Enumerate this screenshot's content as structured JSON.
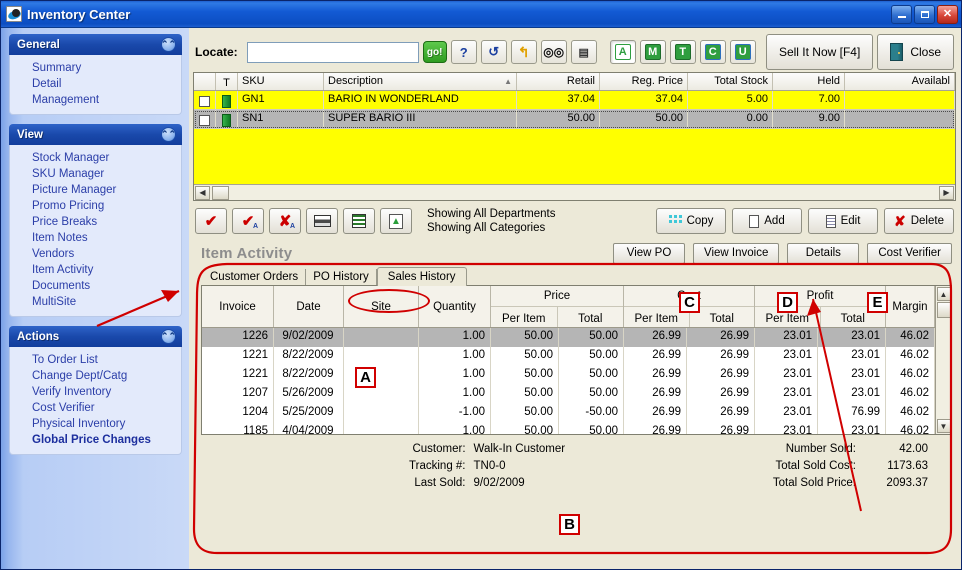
{
  "window": {
    "title": "Inventory Center",
    "minimize": "_",
    "maximize": "❐",
    "close": "✕"
  },
  "sidebar": {
    "groups": [
      {
        "title": "General",
        "collapse_icon": "chevron-up-icon",
        "items": [
          {
            "label": "Summary",
            "bold": false
          },
          {
            "label": "Detail",
            "bold": false
          },
          {
            "label": "Management",
            "bold": false
          }
        ]
      },
      {
        "title": "View",
        "collapse_icon": "chevron-up-icon",
        "items": [
          {
            "label": "Stock Manager",
            "bold": false
          },
          {
            "label": "SKU Manager",
            "bold": false
          },
          {
            "label": "Picture Manager",
            "bold": false
          },
          {
            "label": "Promo Pricing",
            "bold": false
          },
          {
            "label": "Price Breaks",
            "bold": false
          },
          {
            "label": "Item Notes",
            "bold": false
          },
          {
            "label": "Vendors",
            "bold": false
          },
          {
            "label": "Item Activity",
            "bold": false
          },
          {
            "label": "Documents",
            "bold": false
          },
          {
            "label": "MultiSite",
            "bold": false
          }
        ]
      },
      {
        "title": "Actions",
        "collapse_icon": "chevron-up-icon",
        "items": [
          {
            "label": "To Order List",
            "bold": false
          },
          {
            "label": "Change Dept/Catg",
            "bold": false
          },
          {
            "label": "Verify Inventory",
            "bold": false
          },
          {
            "label": "Cost Verifier",
            "bold": false
          },
          {
            "label": "Physical Inventory",
            "bold": false
          },
          {
            "label": "Global Price Changes",
            "bold": true
          }
        ]
      }
    ]
  },
  "toolbar": {
    "locate_label": "Locate:",
    "locate_value": "",
    "locate_placeholder": "",
    "go_label": "go!",
    "icon_buttons": [
      {
        "name": "help-icon",
        "glyph": "?"
      },
      {
        "name": "refresh-icon",
        "glyph": "↺"
      },
      {
        "name": "jump-arrow-icon",
        "glyph": "↰"
      },
      {
        "name": "binoculars-icon",
        "glyph": "🕶"
      },
      {
        "name": "preview-icon",
        "glyph": "🔍"
      }
    ],
    "letter_buttons": [
      {
        "letter": "A",
        "pressed": true
      },
      {
        "letter": "M",
        "pressed": false
      },
      {
        "letter": "T",
        "pressed": false
      },
      {
        "letter": "C",
        "pressed": false
      },
      {
        "letter": "U",
        "pressed": false
      }
    ],
    "sell_now_label": "Sell It Now [F4]",
    "close_label": "Close"
  },
  "item_grid": {
    "columns": [
      "",
      "T",
      "SKU",
      "Description",
      "Retail",
      "Reg. Price",
      "Total Stock",
      "Held",
      "Availabl"
    ],
    "sorted_column": "Description",
    "sort_glyph": "▲",
    "rows": [
      {
        "checked": false,
        "type": "item-type-indicator",
        "sku": "GN1",
        "description": "BARIO IN WONDERLAND",
        "retail": "37.04",
        "reg_price": "37.04",
        "total_stock": "5.00",
        "held": "7.00",
        "available": "",
        "selected": false
      },
      {
        "checked": false,
        "type": "item-type-indicator",
        "sku": "SN1",
        "description": "SUPER BARIO III",
        "retail": "50.00",
        "reg_price": "50.00",
        "total_stock": "0.00",
        "held": "9.00",
        "available": "",
        "selected": true
      }
    ]
  },
  "action_row": {
    "icon_buttons": [
      {
        "name": "check-all-icon",
        "glyph": "✔"
      },
      {
        "name": "check-all-a-icon",
        "glyph": "✔"
      },
      {
        "name": "uncheck-all-icon",
        "glyph": "✘"
      },
      {
        "name": "print-icon",
        "glyph": ""
      },
      {
        "name": "list-icon",
        "glyph": ""
      },
      {
        "name": "export-up-icon",
        "glyph": ""
      }
    ],
    "status_line_1": "Showing All Departments",
    "status_line_2": "Showing All Categories",
    "copy_label": "Copy",
    "add_label": "Add",
    "edit_label": "Edit",
    "delete_label": "Delete"
  },
  "item_activity": {
    "title": "Item Activity",
    "tabs": [
      {
        "label": "Customer Orders",
        "active": false
      },
      {
        "label": "PO History",
        "active": false
      },
      {
        "label": "Sales History",
        "active": true
      }
    ],
    "buttons": [
      {
        "label": "View PO"
      },
      {
        "label": "View Invoice"
      },
      {
        "label": "Details"
      },
      {
        "label": "Cost Verifier"
      }
    ],
    "grid": {
      "headers": {
        "invoice": "Invoice",
        "date": "Date",
        "site": "Site",
        "quantity": "Quantity",
        "price": "Price",
        "cost": "Cost",
        "profit": "Profit",
        "margin": "Margin",
        "per_item": "Per Item",
        "total": "Total"
      },
      "rows": [
        {
          "invoice": "1226",
          "date": "9/02/2009",
          "site": "",
          "quantity": "1.00",
          "price_per": "50.00",
          "price_total": "50.00",
          "cost_per": "26.99",
          "cost_total": "26.99",
          "profit_per": "23.01",
          "profit_total": "23.01",
          "margin": "46.02",
          "selected": true
        },
        {
          "invoice": "1221",
          "date": "8/22/2009",
          "site": "",
          "quantity": "1.00",
          "price_per": "50.00",
          "price_total": "50.00",
          "cost_per": "26.99",
          "cost_total": "26.99",
          "profit_per": "23.01",
          "profit_total": "23.01",
          "margin": "46.02",
          "selected": false
        },
        {
          "invoice": "1221",
          "date": "8/22/2009",
          "site": "",
          "quantity": "1.00",
          "price_per": "50.00",
          "price_total": "50.00",
          "cost_per": "26.99",
          "cost_total": "26.99",
          "profit_per": "23.01",
          "profit_total": "23.01",
          "margin": "46.02",
          "selected": false
        },
        {
          "invoice": "1207",
          "date": "5/26/2009",
          "site": "",
          "quantity": "1.00",
          "price_per": "50.00",
          "price_total": "50.00",
          "cost_per": "26.99",
          "cost_total": "26.99",
          "profit_per": "23.01",
          "profit_total": "23.01",
          "margin": "46.02",
          "selected": false
        },
        {
          "invoice": "1204",
          "date": "5/25/2009",
          "site": "",
          "quantity": "-1.00",
          "price_per": "50.00",
          "price_total": "-50.00",
          "cost_per": "26.99",
          "cost_total": "26.99",
          "profit_per": "23.01",
          "profit_total": "76.99",
          "margin": "46.02",
          "selected": false
        },
        {
          "invoice": "1185",
          "date": "4/04/2009",
          "site": "",
          "quantity": "1.00",
          "price_per": "50.00",
          "price_total": "50.00",
          "cost_per": "26.99",
          "cost_total": "26.99",
          "profit_per": "23.01",
          "profit_total": "23.01",
          "margin": "46.02",
          "selected": false
        }
      ]
    },
    "summary_left": [
      {
        "key": "Customer:",
        "value": "Walk-In Customer"
      },
      {
        "key": "Tracking #:",
        "value": "TN0-0"
      },
      {
        "key": "Last Sold:",
        "value": "9/02/2009"
      }
    ],
    "summary_right": [
      {
        "key": "Number Sold:",
        "value": "42.00"
      },
      {
        "key": "Total Sold Cost:",
        "value": "1173.63"
      },
      {
        "key": "Total Sold Price:",
        "value": "2093.37"
      }
    ]
  },
  "annotations": {
    "markers": [
      {
        "id": "A",
        "label": "A"
      },
      {
        "id": "B",
        "label": "B"
      },
      {
        "id": "C",
        "label": "C"
      },
      {
        "id": "D",
        "label": "D"
      },
      {
        "id": "E",
        "label": "E"
      }
    ],
    "highlight_color": "#d00000"
  }
}
